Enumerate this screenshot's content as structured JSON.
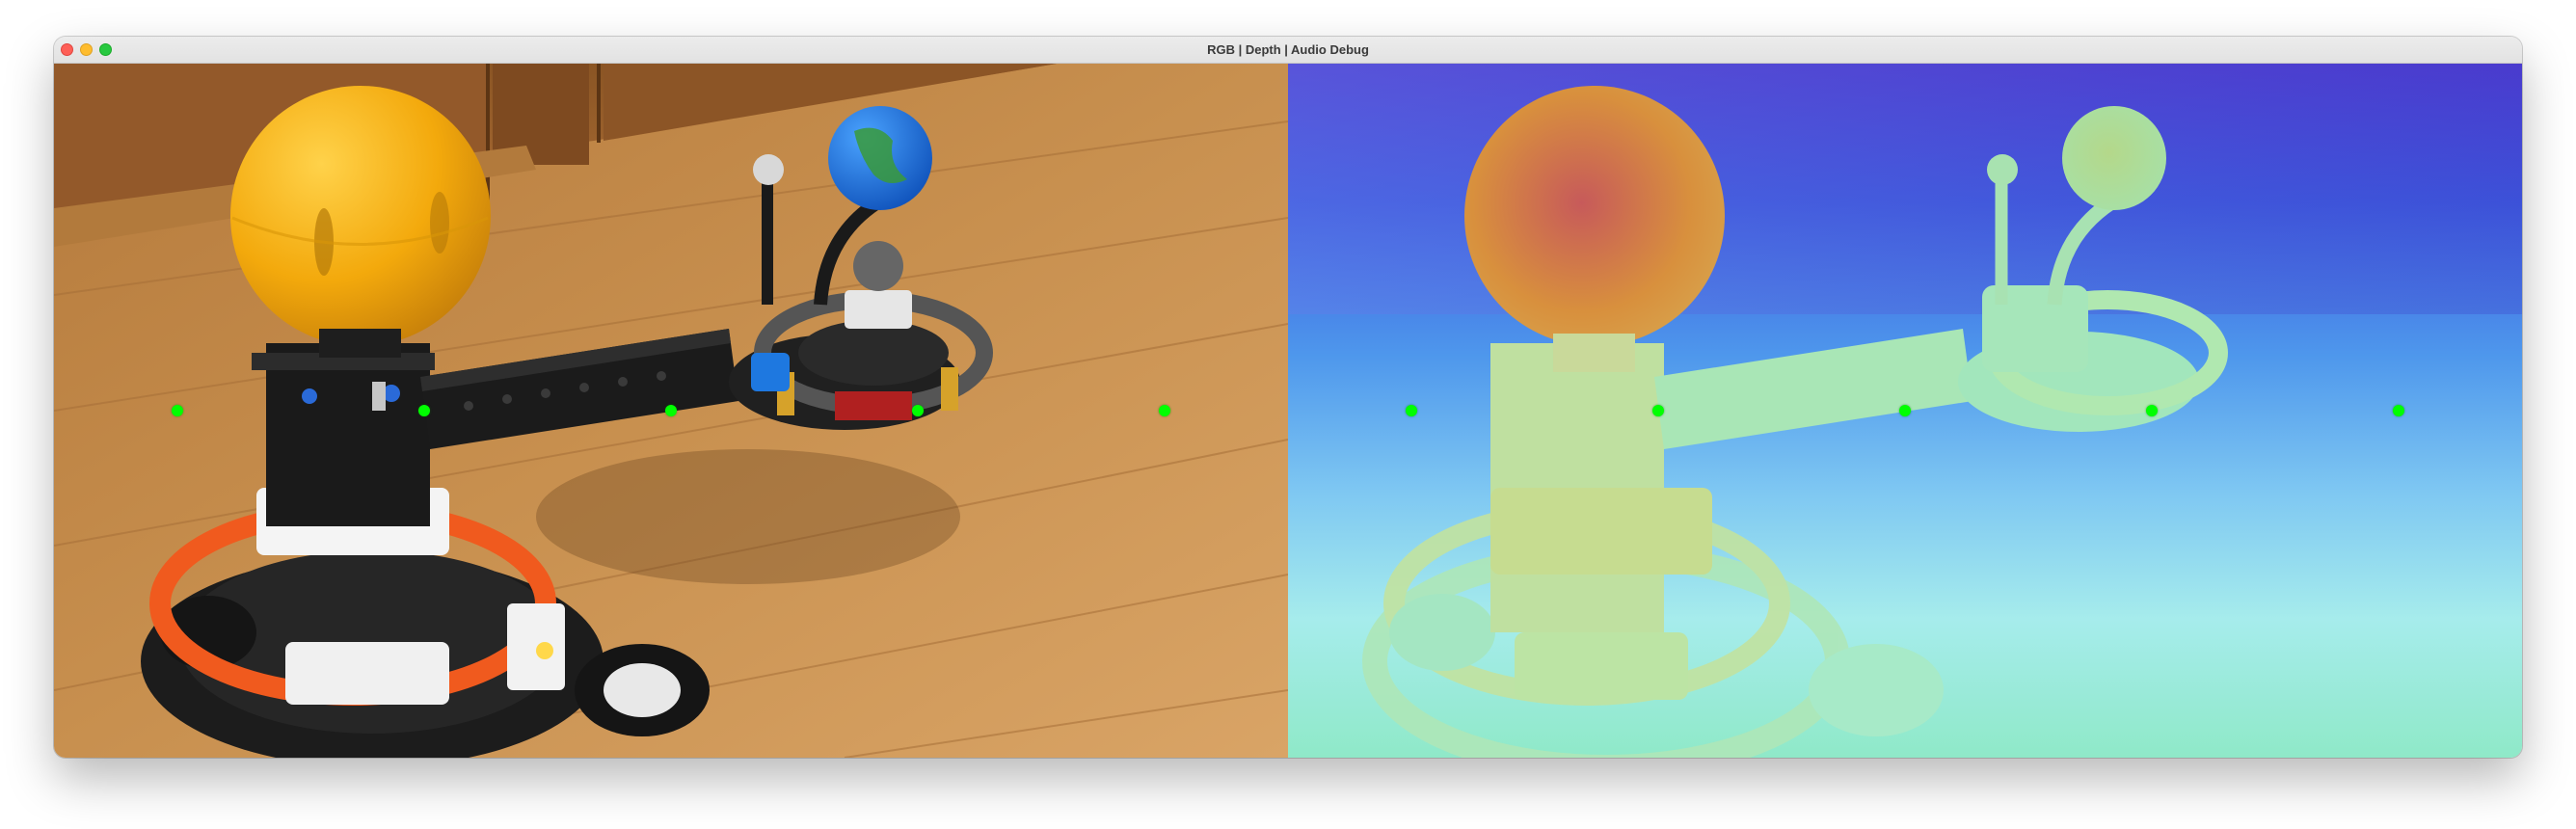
{
  "window": {
    "title": "RGB | Depth | Audio Debug"
  },
  "panes": {
    "rgb": {
      "kind": "rgb-camera-frame"
    },
    "depth": {
      "kind": "depth-map-frame"
    }
  },
  "markers": {
    "color": "#00ff00",
    "count": 10
  },
  "colors": {
    "close": "#fe5f57",
    "minimize": "#febc2e",
    "maximize": "#28c840",
    "marker": "#00ff00"
  }
}
